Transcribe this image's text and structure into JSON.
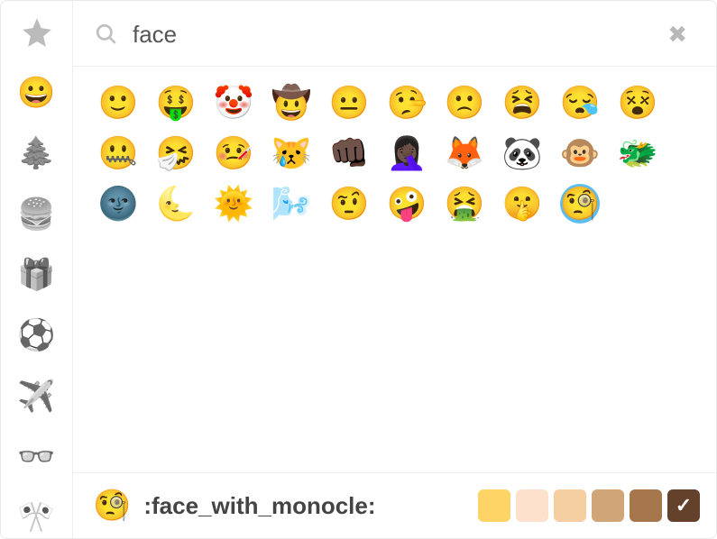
{
  "search": {
    "query": "face",
    "placeholder": "Search"
  },
  "categories": [
    {
      "id": "recent",
      "label": "Recent",
      "glyph": "star",
      "active": false
    },
    {
      "id": "people",
      "label": "Smileys & People",
      "glyph": "😀",
      "active": true
    },
    {
      "id": "nature",
      "label": "Animals & Nature",
      "glyph": "🌲",
      "active": false
    },
    {
      "id": "food",
      "label": "Food & Drink",
      "glyph": "🍔",
      "active": false
    },
    {
      "id": "objects",
      "label": "Objects",
      "glyph": "🎁",
      "active": false
    },
    {
      "id": "activity",
      "label": "Activity",
      "glyph": "⚽",
      "active": false
    },
    {
      "id": "travel",
      "label": "Travel & Places",
      "glyph": "✈️",
      "active": false
    },
    {
      "id": "symbols",
      "label": "Symbols",
      "glyph": "👓",
      "active": false
    },
    {
      "id": "flags",
      "label": "Flags",
      "glyph": "🎌",
      "active": false
    }
  ],
  "results": [
    {
      "name": "slightly_smiling_face",
      "char": "🙂"
    },
    {
      "name": "money_mouth_face",
      "char": "🤑"
    },
    {
      "name": "clown_face",
      "char": "🤡"
    },
    {
      "name": "cowboy_hat_face",
      "char": "🤠"
    },
    {
      "name": "neutral_face",
      "char": "😐"
    },
    {
      "name": "lying_face",
      "char": "🤥"
    },
    {
      "name": "slightly_frowning_face",
      "char": "🙁"
    },
    {
      "name": "tired_face",
      "char": "😫"
    },
    {
      "name": "sleepy_face",
      "char": "😪"
    },
    {
      "name": "dizzy_face",
      "char": "😵"
    },
    {
      "name": "zipper_mouth_face",
      "char": "🤐"
    },
    {
      "name": "sneezing_face",
      "char": "🤧"
    },
    {
      "name": "face_with_thermometer",
      "char": "🤒"
    },
    {
      "name": "crying_cat_face",
      "char": "😿"
    },
    {
      "name": "oncoming_fist",
      "char": "👊🏿"
    },
    {
      "name": "face_palm",
      "char": "🤦🏿‍♀️"
    },
    {
      "name": "fox_face",
      "char": "🦊"
    },
    {
      "name": "panda_face",
      "char": "🐼"
    },
    {
      "name": "monkey_face",
      "char": "🐵"
    },
    {
      "name": "dragon_face",
      "char": "🐲"
    },
    {
      "name": "new_moon_with_face",
      "char": "🌚"
    },
    {
      "name": "last_quarter_moon_with_face",
      "char": "🌜"
    },
    {
      "name": "sun_with_face",
      "char": "🌞"
    },
    {
      "name": "wind_face",
      "char": "🌬️"
    },
    {
      "name": "face_with_raised_eyebrow",
      "char": "🤨"
    },
    {
      "name": "zany_face",
      "char": "🤪"
    },
    {
      "name": "face_vomiting",
      "char": "🤮"
    },
    {
      "name": "shushing_face",
      "char": "🤫"
    },
    {
      "name": "face_with_monocle",
      "char": "🧐",
      "selected": true
    }
  ],
  "preview": {
    "char": "🧐",
    "shortcode": ":face_with_monocle:"
  },
  "skin_tones": [
    {
      "id": "default",
      "color": "#ffd467",
      "selected": false
    },
    {
      "id": "tone1",
      "color": "#fde1cc",
      "selected": false
    },
    {
      "id": "tone2",
      "color": "#f5cfa1",
      "selected": false
    },
    {
      "id": "tone3",
      "color": "#d0a577",
      "selected": false
    },
    {
      "id": "tone4",
      "color": "#a6764c",
      "selected": false
    },
    {
      "id": "tone5",
      "color": "#63412b",
      "selected": true
    }
  ]
}
